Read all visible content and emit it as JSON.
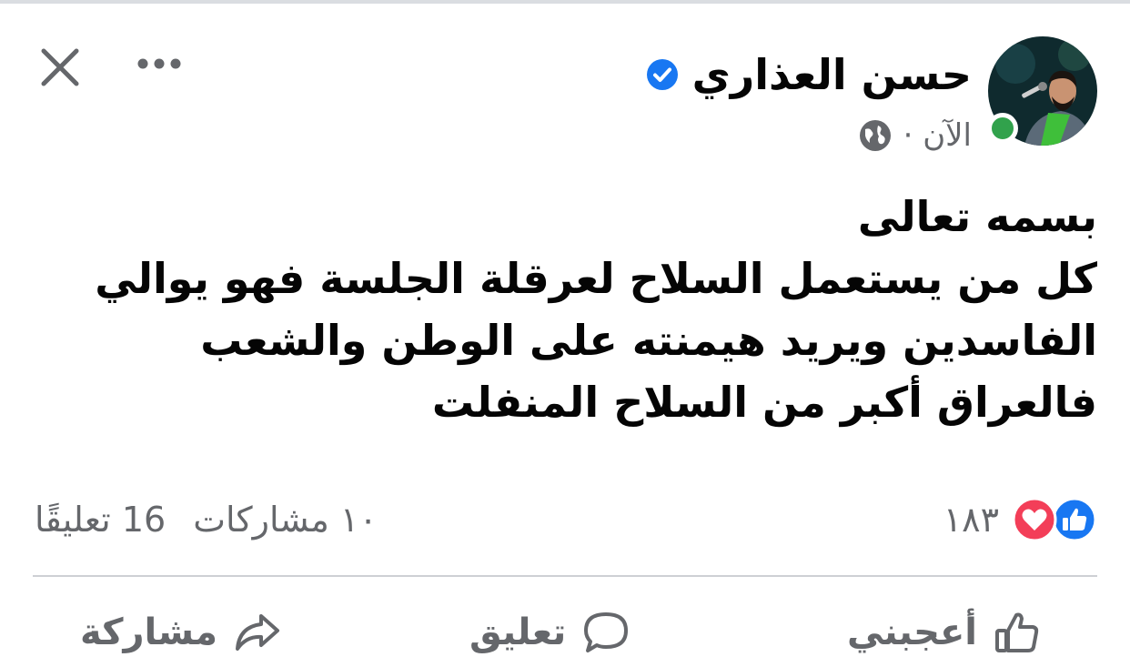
{
  "header": {
    "author_name": "حسن العذاري",
    "timestamp": "الآن ·",
    "verified": true
  },
  "post": {
    "lines": [
      "بسمه تعالى",
      "كل من يستعمل السلاح لعرقلة الجلسة فهو يوالي",
      "الفاسدين ويريد هيمنته على الوطن والشعب",
      "فالعراق أكبر من السلاح المنفلت"
    ]
  },
  "stats": {
    "reactions_count": "١٨٣",
    "shares": "١٠ مشاركات",
    "comments": "16 تعليقًا"
  },
  "actions": {
    "like_label": "أعجبني",
    "comment_label": "تعليق",
    "share_label": "مشاركة"
  },
  "colors": {
    "facebook_blue": "#1877f2",
    "love_red": "#f33e58",
    "online_green": "#31a24c",
    "secondary_text": "#65676b"
  },
  "icons": {
    "close": "close-icon",
    "more": "more-icon",
    "verified": "verified-badge-icon",
    "globe": "globe-icon",
    "like_reaction": "like-reaction-icon",
    "love_reaction": "love-reaction-icon",
    "like": "thumbs-up-icon",
    "comment": "comment-bubble-icon",
    "share": "share-arrow-icon"
  }
}
